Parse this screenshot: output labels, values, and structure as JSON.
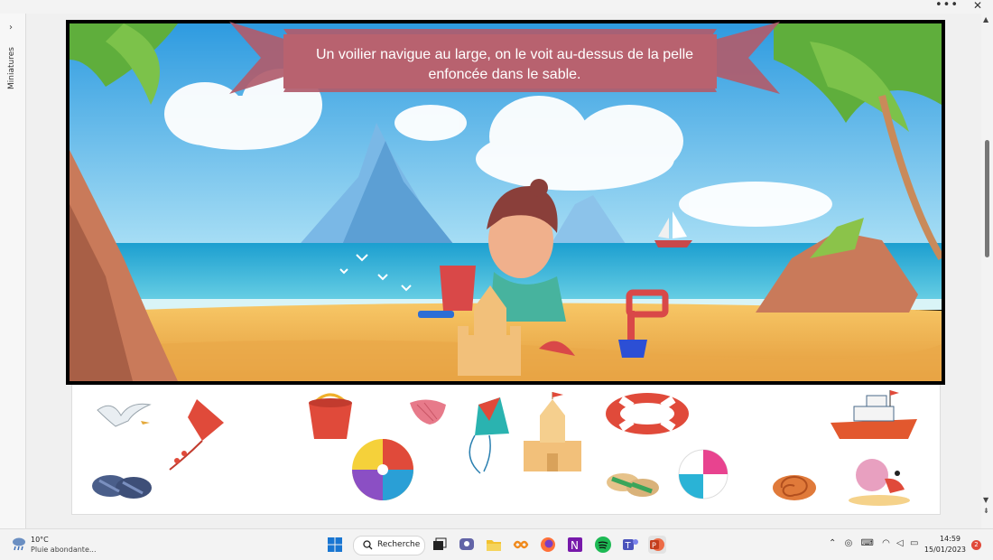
{
  "window": {
    "more_label": "•••",
    "close_label": "✕"
  },
  "sidebar": {
    "toggle_label": "›",
    "label": "Miniatures"
  },
  "slide": {
    "caption_line1": "Un voilier navigue au large, on le voit au-dessus de la pelle",
    "caption_line2": "enfoncée dans le sable."
  },
  "tray_items": [
    "seagull-image",
    "kite-red-image",
    "bucket-image",
    "seashell-image",
    "kite-blue-image",
    "sandcastle-image",
    "lifebuoy-image",
    "boat-image",
    "sandals-blue-image",
    "beachball-image",
    "sandals-green-image",
    "beachball-pink-image",
    "snail-shell-image",
    "hermit-crab-image"
  ],
  "taskbar": {
    "weather_temp": "10°C",
    "weather_desc": "Pluie abondante...",
    "search_label": "Recherche",
    "time": "14:59",
    "date": "15/01/2023",
    "notifications": "2"
  },
  "colors": {
    "accent": "#b55a6a",
    "sea": "#2fb7d6",
    "sand": "#f2b552"
  }
}
